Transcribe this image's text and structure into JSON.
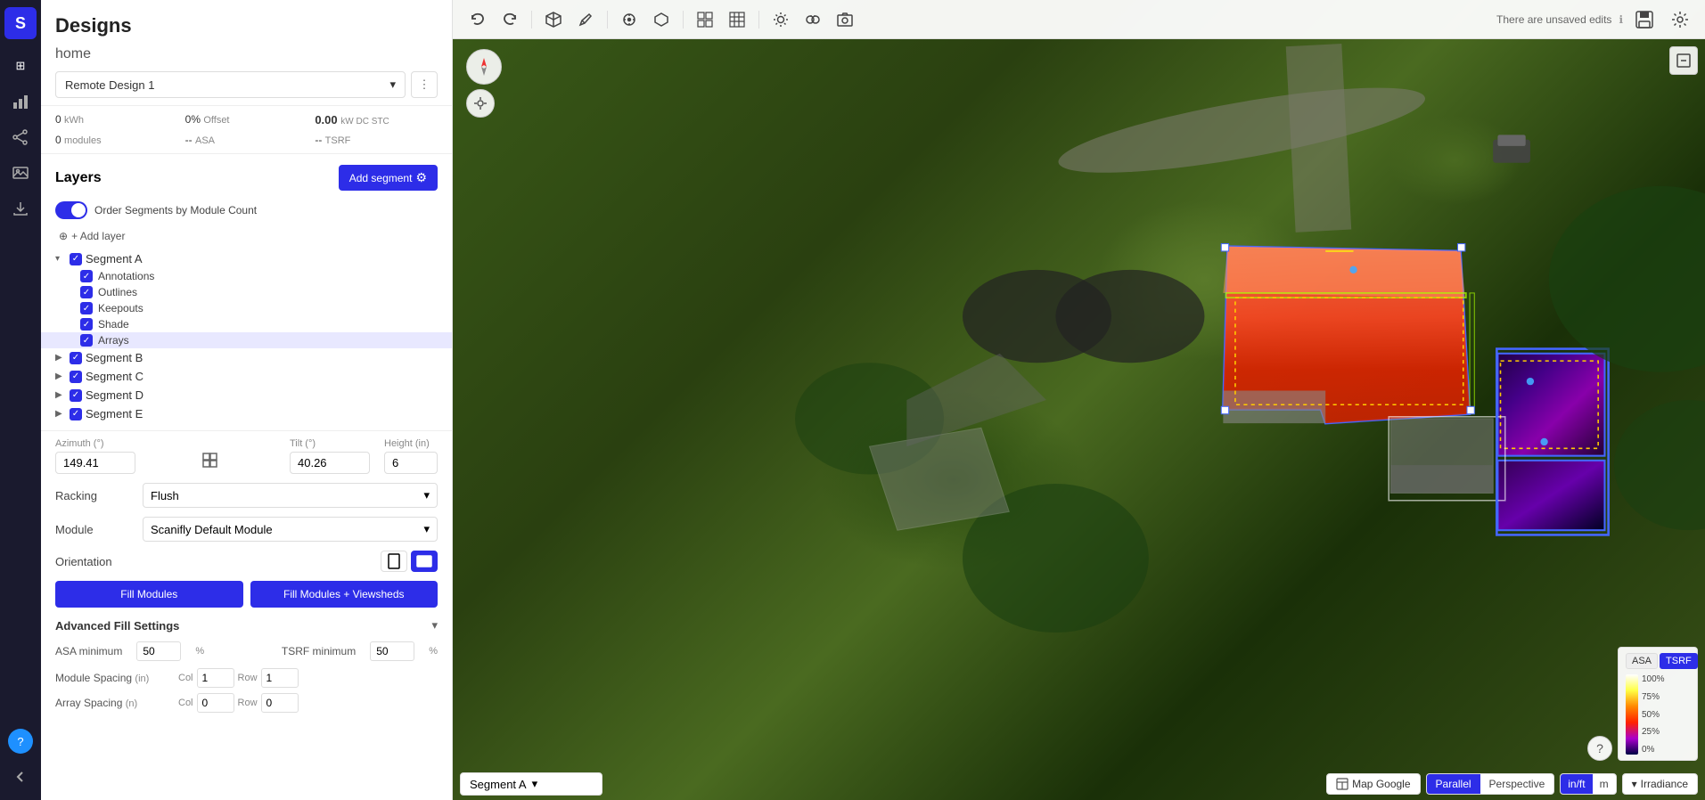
{
  "app": {
    "logo": "S",
    "panel_title": "Designs"
  },
  "sidebar_icons": [
    {
      "name": "designs-icon",
      "glyph": "⊞",
      "active": true
    },
    {
      "name": "chart-icon",
      "glyph": "📊"
    },
    {
      "name": "share-icon",
      "glyph": "↗"
    },
    {
      "name": "image-icon",
      "glyph": "🖼"
    },
    {
      "name": "download-icon",
      "glyph": "⬇"
    },
    {
      "name": "help-icon",
      "glyph": "?"
    },
    {
      "name": "back-icon",
      "glyph": "←"
    }
  ],
  "header": {
    "project_name": "home",
    "design_name": "Remote Design 1"
  },
  "stats": {
    "kwh": "0",
    "kwh_label": "kWh",
    "offset_pct": "0%",
    "offset_label": "Offset",
    "kw_dc": "0.00",
    "kw_dc_label": "kW DC STC",
    "modules": "0",
    "modules_label": "modules",
    "asa": "--",
    "asa_label": "ASA",
    "tsrf": "--",
    "tsrf_label": "TSRF"
  },
  "layers": {
    "title": "Layers",
    "add_segment_label": "Add segment",
    "order_label": "Order Segments by Module Count",
    "add_layer_label": "+ Add layer",
    "segments": [
      {
        "name": "Segment A",
        "expanded": true,
        "checked": true,
        "children": [
          "Annotations",
          "Outlines",
          "Keepouts",
          "Shade",
          "Arrays"
        ]
      },
      {
        "name": "Segment B",
        "expanded": false,
        "checked": true
      },
      {
        "name": "Segment C",
        "expanded": false,
        "checked": true
      },
      {
        "name": "Segment D",
        "expanded": false,
        "checked": true
      },
      {
        "name": "Segment E",
        "expanded": false,
        "checked": true
      }
    ]
  },
  "array_settings": {
    "azimuth_label": "Azimuth (°)",
    "azimuth_value": "149.41",
    "tilt_label": "Tilt (°)",
    "tilt_value": "40.26",
    "height_label": "Height (in)",
    "height_value": "6",
    "racking_label": "Racking",
    "racking_value": "Flush",
    "module_label": "Module",
    "module_value": "Scanifly Default Module",
    "orientation_label": "Orientation",
    "orientation_portrait": "▭",
    "orientation_landscape": "▯",
    "fill_modules_label": "Fill Modules",
    "fill_modules_viewsheds_label": "Fill Modules + Viewsheds"
  },
  "advanced": {
    "title": "Advanced Fill Settings",
    "asa_min_label": "ASA minimum",
    "asa_min_value": "50",
    "asa_unit": "%",
    "tsrf_min_label": "TSRF minimum",
    "tsrf_min_value": "50",
    "tsrf_unit": "%",
    "module_spacing_label": "Module Spacing",
    "module_spacing_unit": "(in)",
    "mod_col_label": "Col",
    "mod_col_value": "1",
    "mod_row_label": "Row",
    "mod_row_value": "1",
    "array_spacing_label": "Array Spacing",
    "array_spacing_unit": "(n)",
    "arr_col_label": "Col",
    "arr_col_value": "0",
    "arr_row_label": "Row",
    "arr_row_value": "0"
  },
  "toolbar": {
    "undo_label": "↩",
    "redo_label": "↪",
    "unsaved_text": "There are unsaved edits",
    "save_label": "💾",
    "settings_label": "⚙"
  },
  "map": {
    "segment_selector": "Segment A",
    "map_provider": "Map Google",
    "parallel_label": "Parallel",
    "perspective_label": "Perspective",
    "unit_in_label": "in/ft",
    "unit_m_label": "m",
    "irradiance_label": "Irradiance",
    "asa_tab": "ASA",
    "tsrf_tab": "TSRF",
    "legend_values": [
      "100%",
      "75%",
      "50%",
      "25%",
      "0%"
    ]
  }
}
